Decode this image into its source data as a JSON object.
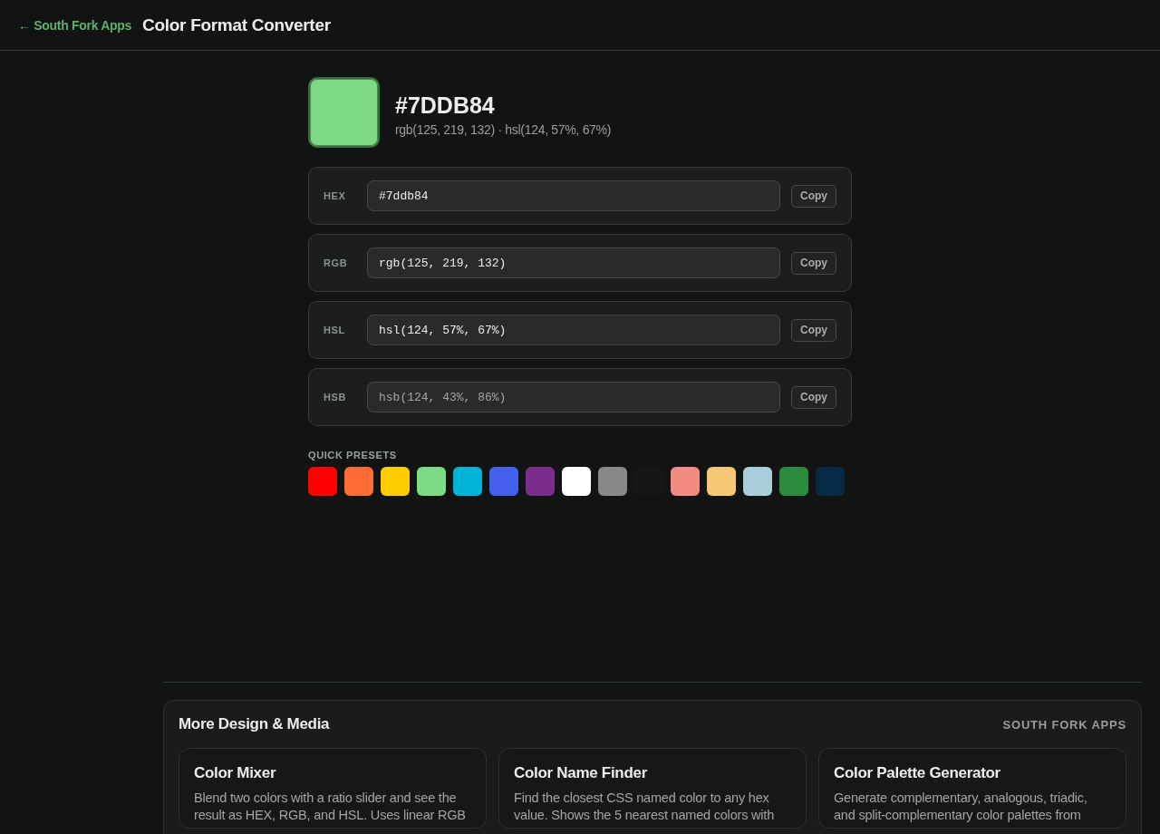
{
  "header": {
    "back_link": "← South Fork Apps",
    "title": "Color Format Converter"
  },
  "current": {
    "color": "#7ddb84",
    "hex": "#7DDB84",
    "summary": "rgb(125, 219, 132) · hsl(124, 57%, 67%)"
  },
  "formats": [
    {
      "label": "HEX",
      "value": "#7ddb84",
      "button": "Copy",
      "disabled": false
    },
    {
      "label": "RGB",
      "value": "rgb(125, 219, 132)",
      "button": "Copy",
      "disabled": false
    },
    {
      "label": "HSL",
      "value": "hsl(124, 57%, 67%)",
      "button": "Copy",
      "disabled": false
    },
    {
      "label": "HSB",
      "value": "hsb(124, 43%, 86%)",
      "button": "Copy",
      "disabled": true
    }
  ],
  "presets": {
    "title": "QUICK PRESETS",
    "swatches": [
      {
        "color": "#ff0000"
      },
      {
        "color": "#ff6b35"
      },
      {
        "color": "#ffcc00"
      },
      {
        "color": "#7ddb84"
      },
      {
        "color": "#00b4d8"
      },
      {
        "color": "#4361ee"
      },
      {
        "color": "#7b2d8e"
      },
      {
        "color": "#ffffff"
      },
      {
        "color": "#888888"
      },
      {
        "color": "#161616"
      },
      {
        "color": "#f28b82"
      },
      {
        "color": "#f7c873"
      },
      {
        "color": "#a8cddb"
      },
      {
        "color": "#2a8a3e"
      },
      {
        "color": "#062b45"
      }
    ]
  },
  "related": {
    "title": "More Design & Media",
    "brand": "SOUTH FORK APPS",
    "cards": [
      {
        "title": "Color Mixer",
        "description": "Blend two colors with a ratio slider and see the result as HEX, RGB, and HSL. Uses linear RGB"
      },
      {
        "title": "Color Name Finder",
        "description": "Find the closest CSS named color to any hex value. Shows the 5 nearest named colors with"
      },
      {
        "title": "Color Palette Generator",
        "description": "Generate complementary, analogous, triadic, and split-complementary color palettes from"
      }
    ]
  }
}
